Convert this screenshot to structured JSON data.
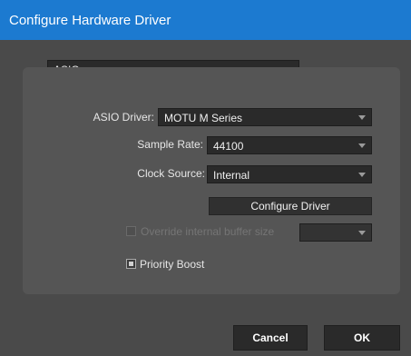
{
  "window": {
    "title": "Configure Hardware Driver"
  },
  "driver_type": {
    "value": "ASIO"
  },
  "fields": {
    "asio_driver": {
      "label": "ASIO Driver:",
      "value": "MOTU M Series"
    },
    "sample_rate": {
      "label": "Sample Rate:",
      "value": "44100"
    },
    "clock_source": {
      "label": "Clock Source:",
      "value": "Internal"
    }
  },
  "configure_driver": {
    "label": "Configure Driver"
  },
  "override_buffer": {
    "label": "Override internal buffer size",
    "checked": false,
    "enabled": false,
    "value": ""
  },
  "priority_boost": {
    "label": "Priority Boost",
    "checked": true
  },
  "footer": {
    "cancel_label": "Cancel",
    "ok_label": "OK"
  },
  "colors": {
    "titlebar": "#1c7ad0",
    "window_bg": "#4a4a4a",
    "panel_bg": "#555555",
    "control_bg": "#2a2a2a"
  },
  "icons": {
    "dropdown": "chevron-down-icon",
    "checkbox": "checkbox-icon"
  }
}
